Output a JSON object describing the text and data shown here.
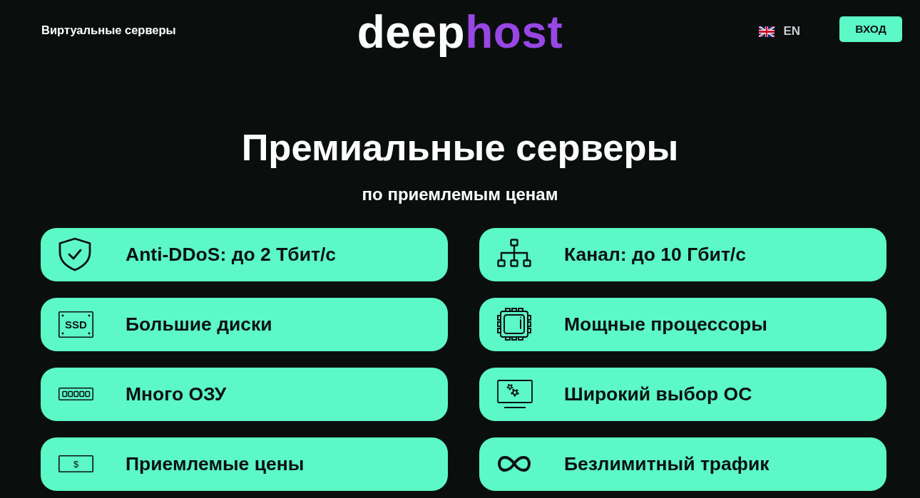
{
  "header": {
    "nav_link": "Виртуальные серверы",
    "logo": [
      {
        "text": "deep",
        "color": "#ffffff"
      },
      {
        "text": "host",
        "color": "#9747e3"
      }
    ],
    "language": "EN",
    "login_button": "ВХОД"
  },
  "hero": {
    "title": "Премиальные серверы",
    "subtitle": "по приемлемым ценам"
  },
  "features": [
    {
      "kind": "shield",
      "label": "Anti-DDoS: до 2 Тбит/с"
    },
    {
      "kind": "network",
      "label": "Канал: до 10 Гбит/с"
    },
    {
      "kind": "ssd",
      "icon_text": "SSD",
      "label": "Большие диски"
    },
    {
      "kind": "cpu",
      "label": "Мощные процессоры"
    },
    {
      "kind": "ram",
      "label": "Много ОЗУ"
    },
    {
      "kind": "monitor",
      "label": "Широкий выбор ОС"
    },
    {
      "kind": "money",
      "icon_text": "$",
      "label": "Приемлемые цены"
    },
    {
      "kind": "infinity",
      "label": "Безлимитный трафик"
    }
  ]
}
